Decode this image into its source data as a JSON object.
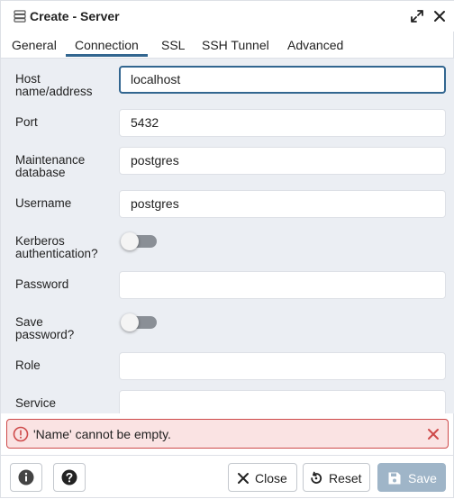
{
  "window": {
    "title": "Create - Server",
    "icons": [
      "server-icon",
      "expand-icon",
      "close-icon"
    ]
  },
  "tabs": [
    {
      "label": "General",
      "active": false
    },
    {
      "label": "Connection",
      "active": true
    },
    {
      "label": "SSL",
      "active": false
    },
    {
      "label": "SSH Tunnel",
      "active": false
    },
    {
      "label": "Advanced",
      "active": false
    }
  ],
  "form": {
    "host": {
      "label_line1": "Host",
      "label_line2": "name/address",
      "value": "localhost"
    },
    "port": {
      "label": "Port",
      "value": "5432"
    },
    "maintenance_db": {
      "label_line1": "Maintenance",
      "label_line2": "database",
      "value": "postgres"
    },
    "username": {
      "label": "Username",
      "value": "postgres"
    },
    "kerberos": {
      "label_line1": "Kerberos",
      "label_line2": "authentication?",
      "enabled": false
    },
    "password": {
      "label": "Password",
      "value": ""
    },
    "save_password": {
      "label_line1": "Save",
      "label_line2": "password?",
      "enabled": false
    },
    "role": {
      "label": "Role",
      "value": ""
    },
    "service": {
      "label": "Service",
      "value": ""
    }
  },
  "error": {
    "message": "'Name' cannot be empty.",
    "icons": [
      "alert-circle-icon",
      "close-icon"
    ]
  },
  "footer": {
    "close_label": "Close",
    "reset_label": "Reset",
    "save_label": "Save",
    "icons": [
      "info-icon",
      "help-icon",
      "close-icon",
      "reset-icon",
      "save-icon"
    ]
  },
  "colors": {
    "accent": "#326690",
    "form_background": "#ebeef3",
    "error_border": "#ce4a4a",
    "error_background": "#fae3e3",
    "save_disabled": "#9fb5c8"
  }
}
